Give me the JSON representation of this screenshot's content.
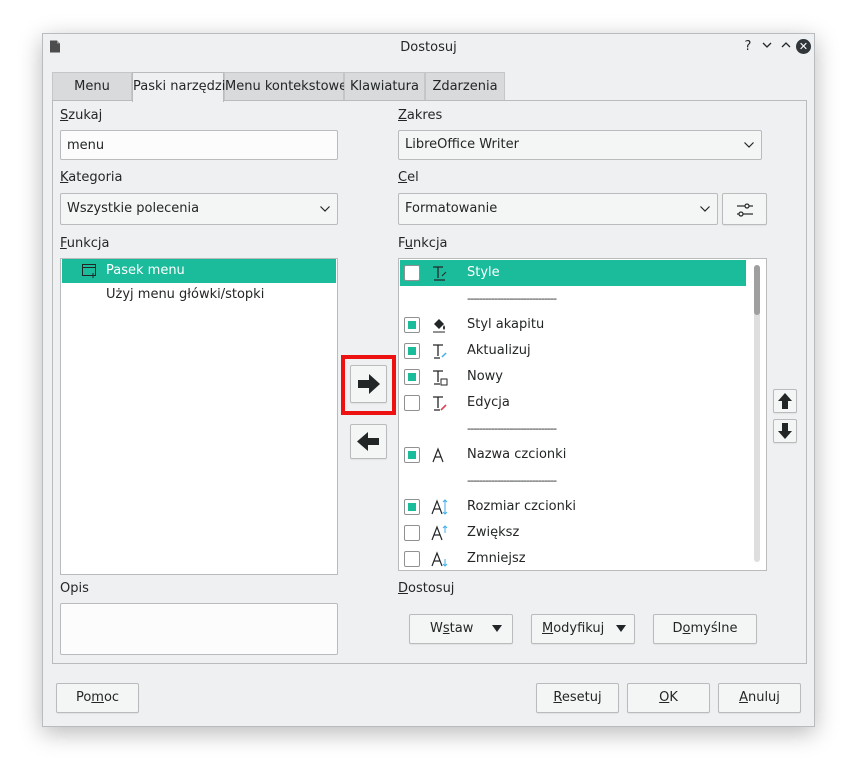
{
  "window": {
    "title": "Dostosuj",
    "help_glyph": "?",
    "minimize_glyph": "⌄",
    "maximize_glyph": "⌃",
    "close_glyph": "✕"
  },
  "tabs": [
    {
      "label": "Menu",
      "active": false
    },
    {
      "label": "Paski narzędzi",
      "active": true
    },
    {
      "label": "Menu kontekstowe",
      "active": false
    },
    {
      "label": "Klawiatura",
      "active": false
    },
    {
      "label": "Zdarzenia",
      "active": false
    }
  ],
  "left": {
    "search_label_u": "S",
    "search_label_rest": "zukaj",
    "search_value": "menu",
    "category_label_u": "K",
    "category_label_rest": "ategoria",
    "category_value": "Wszystkie polecenia",
    "function_label_u": "F",
    "function_label_rest": "unkcja",
    "functions": [
      {
        "label": "Pasek menu",
        "icon": "menubar-icon",
        "selected": true
      },
      {
        "label": "Użyj menu główki/stopki",
        "icon": "",
        "selected": false
      }
    ],
    "description_label": "Opis",
    "description_value": ""
  },
  "right": {
    "scope_label_u": "Z",
    "scope_label_rest": "akres",
    "scope_value": "LibreOffice Writer",
    "target_label_u": "C",
    "target_label_rest": "el",
    "target_value": "Formatowanie",
    "function_label_u": "u",
    "function_label_pre": "F",
    "function_label_post": "nkcja",
    "entries": [
      {
        "label": "Style",
        "checked": false,
        "icon": "style-icon",
        "separator": false,
        "selected": true
      },
      {
        "label": "------------------------------",
        "checked": null,
        "icon": "",
        "separator": true,
        "selected": false
      },
      {
        "label": "Styl akapitu",
        "checked": true,
        "icon": "paint-bucket-icon",
        "separator": false,
        "selected": false
      },
      {
        "label": "Aktualizuj",
        "checked": true,
        "icon": "update-style-icon",
        "separator": false,
        "selected": false
      },
      {
        "label": "Nowy",
        "checked": true,
        "icon": "new-style-icon",
        "separator": false,
        "selected": false
      },
      {
        "label": "Edycja",
        "checked": false,
        "icon": "edit-style-icon",
        "separator": false,
        "selected": false
      },
      {
        "label": "------------------------------",
        "checked": null,
        "icon": "",
        "separator": true,
        "selected": false
      },
      {
        "label": "Nazwa czcionki",
        "checked": true,
        "icon": "font-name-icon",
        "separator": false,
        "selected": false
      },
      {
        "label": "------------------------------",
        "checked": null,
        "icon": "",
        "separator": true,
        "selected": false
      },
      {
        "label": "Rozmiar czcionki",
        "checked": true,
        "icon": "font-size-icon",
        "separator": false,
        "selected": false
      },
      {
        "label": "Zwiększ",
        "checked": false,
        "icon": "grow-font-icon",
        "separator": false,
        "selected": false
      },
      {
        "label": "Zmniejsz",
        "checked": false,
        "icon": "shrink-font-icon",
        "separator": false,
        "selected": false
      }
    ],
    "customize_label_u": "D",
    "customize_label_rest": "ostosuj",
    "insert_pre": "W",
    "insert_u": "s",
    "insert_post": "taw",
    "modify_u": "M",
    "modify_rest": "odyfikuj",
    "defaults_pre": "D",
    "defaults_u": "o",
    "defaults_post": "myślne"
  },
  "footer": {
    "help_pre": "Po",
    "help_u": "m",
    "help_post": "oc",
    "reset_u": "R",
    "reset_rest": "esetuj",
    "ok_u": "O",
    "ok_rest": "K",
    "cancel_u": "A",
    "cancel_rest": "nuluj"
  },
  "colors": {
    "accent": "#1abc9c",
    "highlight_frame": "#ee1111"
  }
}
